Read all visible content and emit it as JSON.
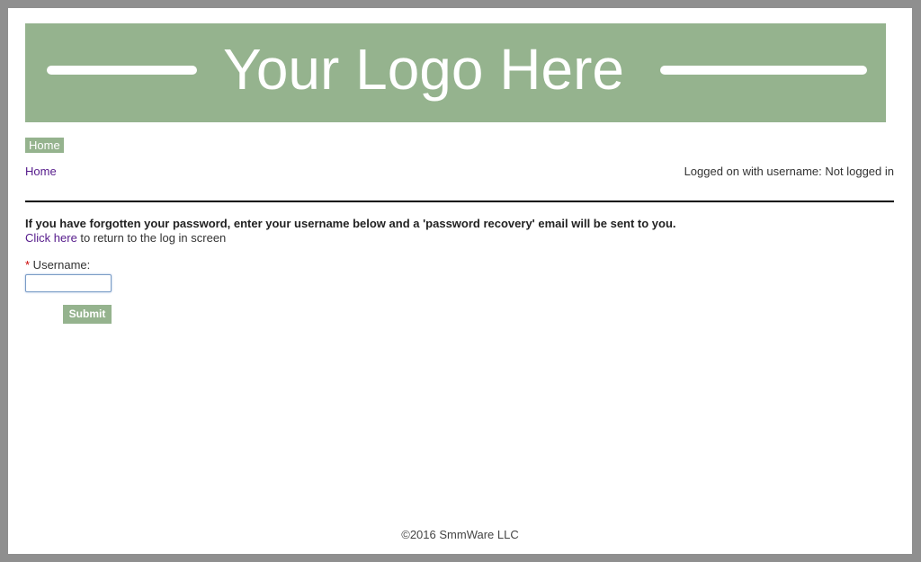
{
  "colors": {
    "brand_green": "#95b38e",
    "link_purple": "#551a8b",
    "frame_gray": "#8f8f8f",
    "required_red": "#cc0000"
  },
  "header": {
    "logo_text": "Your Logo Here"
  },
  "nav": {
    "items": [
      {
        "label": "Home"
      }
    ]
  },
  "breadcrumb": {
    "home_label": "Home"
  },
  "status": {
    "login_text": "Logged on with username: Not logged in"
  },
  "form": {
    "instructions": "If you have forgotten your password, enter your username below and a 'password recovery' email will be sent to you.",
    "return_link_label": "Click here",
    "return_suffix": " to return to the log in screen",
    "required_marker": "*",
    "username_label": " Username:",
    "username_value": "",
    "submit_label": "Submit"
  },
  "footer": {
    "copyright": "©2016 SmmWare LLC"
  }
}
